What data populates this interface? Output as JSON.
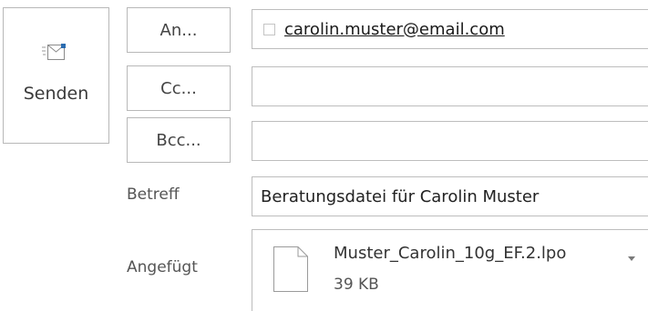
{
  "send_button": {
    "label": "Senden",
    "icon": "send-mail-icon"
  },
  "recipients": {
    "to_button": "An...",
    "cc_button": "Cc...",
    "bcc_button": "Bcc...",
    "to_value": "carolin.muster@email.com",
    "cc_value": "",
    "bcc_value": ""
  },
  "subject": {
    "label": "Betreff",
    "value": "Beratungsdatei für Carolin Muster"
  },
  "attachments": {
    "label": "Angefügt",
    "items": [
      {
        "name": "Muster_Carolin_10g_EF.2.lpo",
        "size": "39 KB",
        "icon": "document-icon"
      }
    ]
  },
  "colors": {
    "border": "#bdbdbd",
    "text": "#444444",
    "send_icon_accent": "#2b6cb0"
  }
}
